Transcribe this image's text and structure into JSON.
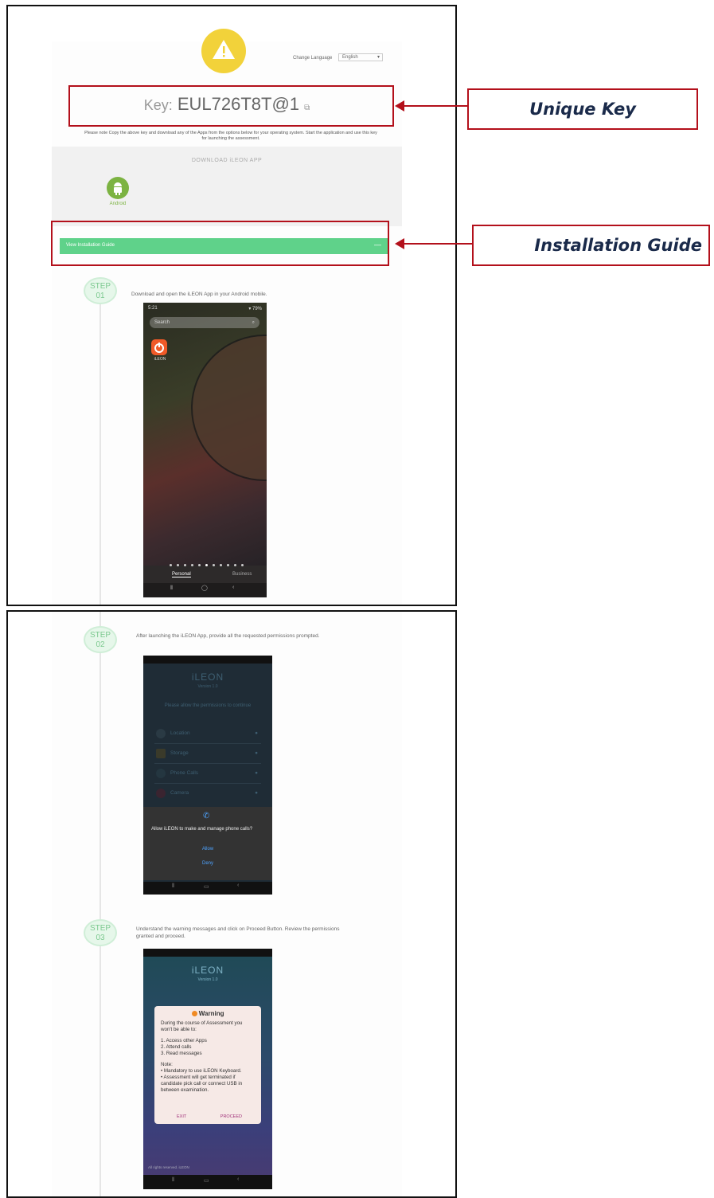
{
  "header": {
    "change_language_label": "Change Language",
    "language_value": "English",
    "key_label": "Key:",
    "key_value": "EUL726T8T@1",
    "instructions": "Please note Copy the above key and download any of the Apps from the options below for your operating system. Start the application and use this key for launching the assessment.",
    "download_heading": "DOWNLOAD iLEON APP",
    "android_label": "Android"
  },
  "installation_guide": {
    "bar_label": "View Installation Guide",
    "collapse_symbol": "—"
  },
  "callouts": {
    "unique_key": "Unique Key",
    "installation_guide": "Installation Guide"
  },
  "steps": [
    {
      "badge_top": "STEP",
      "badge_num": "01",
      "text": "Download and open the iLEON App in your Android mobile."
    },
    {
      "badge_top": "STEP",
      "badge_num": "02",
      "text": "After launching the iLEON App, provide all the requested permissions prompted."
    },
    {
      "badge_top": "STEP",
      "badge_num": "03",
      "text": "Understand the warning messages and click on Proceed Button. Review the permissions granted and proceed."
    }
  ],
  "phone1": {
    "status_left": "5:21 ",
    "status_right": "▾ 79% ",
    "search_placeholder": "Search",
    "app_name": "iLEON",
    "tab_personal": "Personal",
    "tab_work": "Business"
  },
  "phone2": {
    "app_title": "iLEON",
    "app_version": "Version 1.0",
    "heading": "Please allow the permissions to continue",
    "permissions": [
      "Location",
      "Storage",
      "Phone Calls",
      "Camera"
    ],
    "dialog_text": "Allow iLEON to make and manage phone calls?",
    "allow": "Allow",
    "deny": "Deny"
  },
  "phone3": {
    "app_title": "iLEON",
    "app_version": "Version 1.0",
    "warning_title": "Warning",
    "warning_intro": "During the course of Assessment you won't be able to:",
    "warning_items": [
      "1. Access other Apps",
      "2. Attend calls",
      "3. Read messages"
    ],
    "note_label": "Note:",
    "note_lines": [
      "• Mandatory to use iLEON Keyboard.",
      "• Assessment will get terminated if candidate pick call or connect USB in between examination."
    ],
    "exit": "Exit",
    "proceed": "Proceed",
    "footer_text": "All rights reserved. iLEON"
  },
  "colors": {
    "green_bar": "#5fd28a",
    "red_annotation": "#b3101b",
    "warning_yellow": "#f2d23a",
    "android_green": "#7cb342"
  }
}
